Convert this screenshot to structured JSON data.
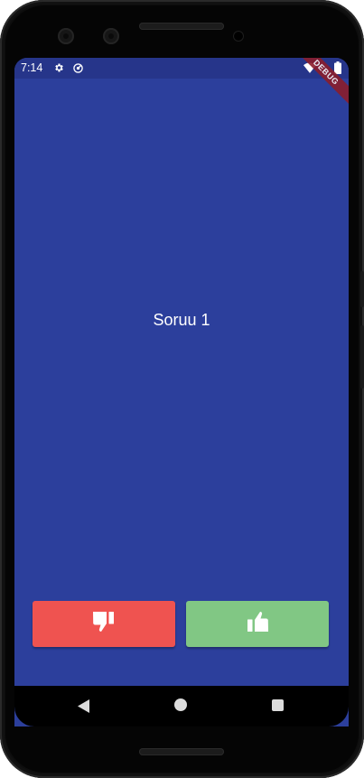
{
  "status_bar": {
    "time": "7:14",
    "icons": [
      "gear-icon",
      "sync-icon",
      "wifi-icon",
      "battery-icon"
    ]
  },
  "debug_banner": "DEBUG",
  "question": {
    "text": "Soruu 1"
  },
  "answers": {
    "false_button_icon": "thumbs-down-icon",
    "true_button_icon": "thumbs-up-icon"
  },
  "colors": {
    "background": "#2c3f9c",
    "status_bar": "#26358a",
    "false_button": "#ef5350",
    "true_button": "#81c784"
  },
  "nav_bar": {
    "icons": [
      "back-icon",
      "home-icon",
      "recents-icon"
    ]
  }
}
